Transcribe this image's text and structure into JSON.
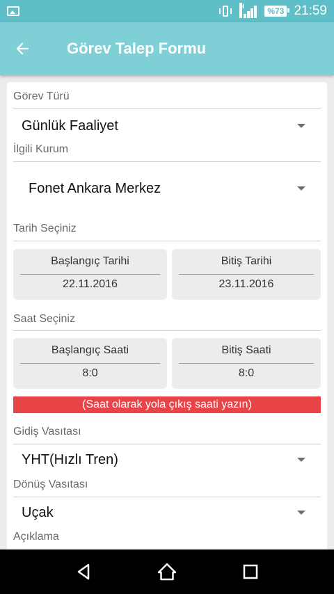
{
  "status_bar": {
    "battery": "%73",
    "time": "21:59"
  },
  "app_bar": {
    "title": "Görev Talep Formu"
  },
  "form": {
    "task_type": {
      "label": "Görev Türü",
      "value": "Günlük Faaliyet"
    },
    "institution": {
      "label": "İlgili Kurum",
      "value": "Fonet Ankara Merkez"
    },
    "date": {
      "label": "Tarih Seçiniz",
      "start": {
        "title": "Başlangıç Tarihi",
        "value": "22.11.2016"
      },
      "end": {
        "title": "Bitiş Tarihi",
        "value": "23.11.2016"
      }
    },
    "time": {
      "label": "Saat Seçiniz",
      "start": {
        "title": "Başlangıç Saati",
        "value": "8:0"
      },
      "end": {
        "title": "Bitiş Saati",
        "value": "8:0"
      }
    },
    "warning": "(Saat olarak yola çıkış saati yazın)",
    "departure_vehicle": {
      "label": "Gidiş Vasıtası",
      "value": "YHT(Hızlı Tren)"
    },
    "return_vehicle": {
      "label": "Dönüş Vasıtası",
      "value": "Uçak"
    },
    "description": {
      "label": "Açıklama"
    }
  },
  "colors": {
    "status_bar": "#5fbfc9",
    "app_bar": "#7fd0d6",
    "warning": "#e84448"
  }
}
